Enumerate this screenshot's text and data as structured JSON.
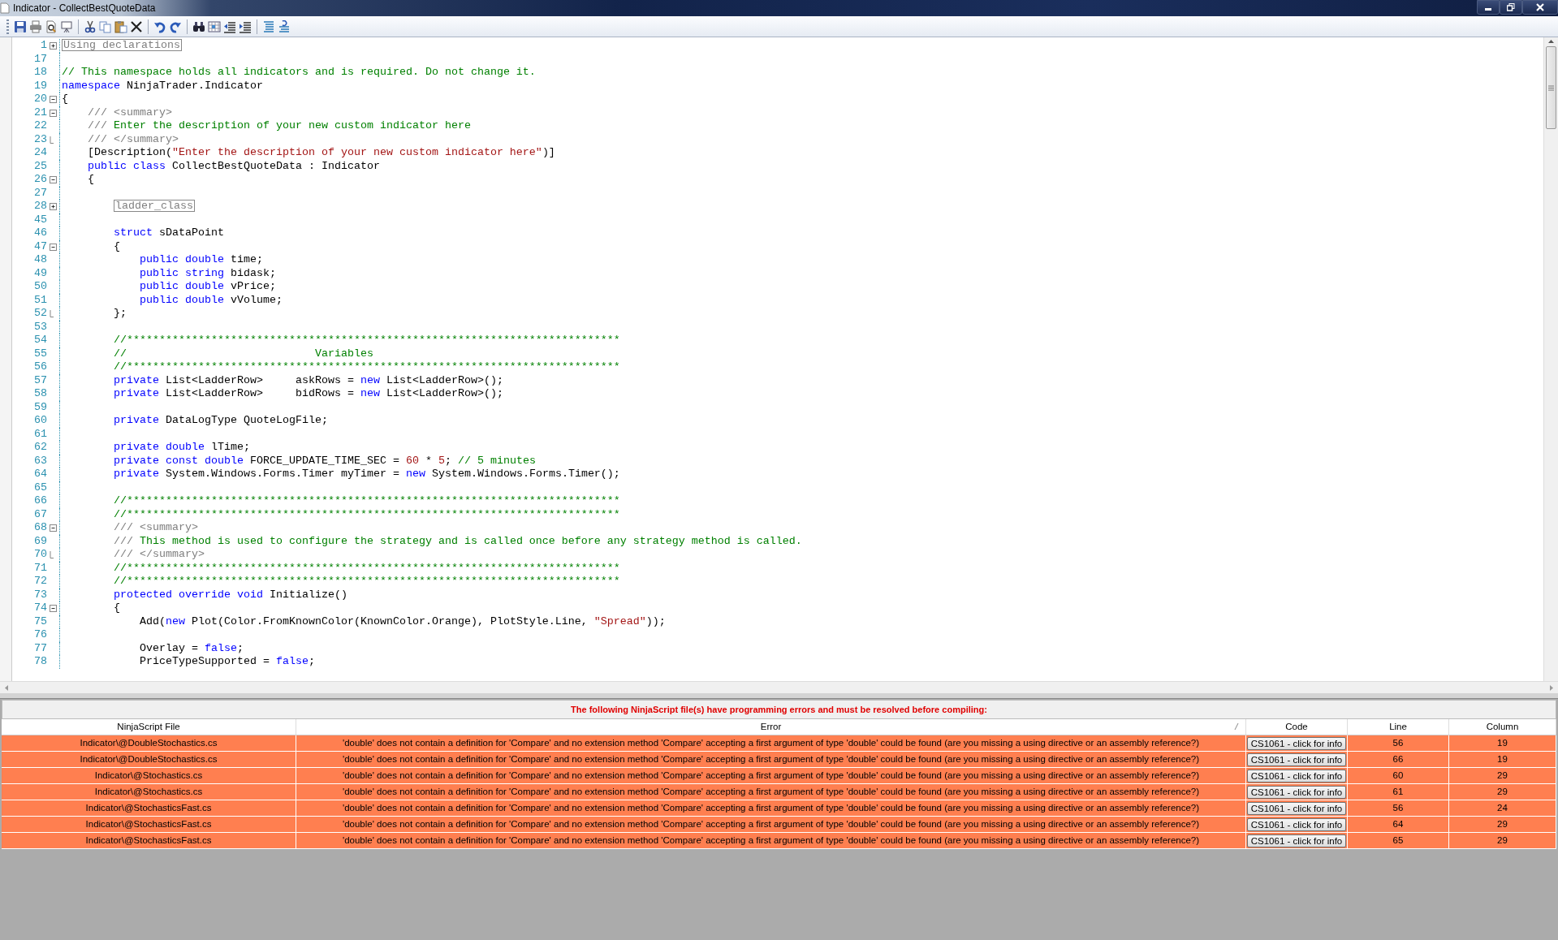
{
  "window": {
    "title": "Indicator - CollectBestQuoteData"
  },
  "editor": {
    "lines": [
      {
        "number": "1",
        "expanded": false,
        "tokens": [
          {
            "kind": "collapsed",
            "text": "Using declarations"
          }
        ]
      },
      {
        "number": "17"
      },
      {
        "number": "18",
        "tokens": [
          {
            "kind": "comment",
            "text": "// This namespace holds all indicators and is required. Do not change it."
          }
        ]
      },
      {
        "number": "19",
        "tokens": [
          {
            "kind": "keyword",
            "text": "namespace"
          },
          {
            "kind": "plain",
            "text": " NinjaTrader.Indicator"
          }
        ]
      },
      {
        "number": "20",
        "expanded": true,
        "tokens": [
          {
            "kind": "plain",
            "text": "{"
          }
        ],
        "children": [
          {
            "number": "21",
            "expanded": true,
            "tokens": [
              {
                "kind": "doc",
                "text": "/// <summary>"
              }
            ]
          },
          {
            "number": "22",
            "tokens": [
              {
                "kind": "doc",
                "text": "///"
              },
              {
                "kind": "comment",
                "text": " Enter the description of your new custom indicator here"
              }
            ]
          },
          {
            "number": "23",
            "fold_end": true,
            "tokens": [
              {
                "kind": "doc",
                "text": "/// </summary>"
              }
            ]
          },
          {
            "number": "24",
            "tokens": [
              {
                "kind": "plain",
                "text": "[Description("
              },
              {
                "kind": "string",
                "text": "\"Enter the description of your new custom indicator here\""
              },
              {
                "kind": "plain",
                "text": ")]"
              }
            ]
          },
          {
            "number": "25",
            "tokens": [
              {
                "kind": "keyword",
                "text": "public class"
              },
              {
                "kind": "plain",
                "text": " CollectBestQuoteData : Indicator"
              }
            ]
          },
          {
            "number": "26",
            "expanded": true,
            "tokens": [
              {
                "kind": "plain",
                "text": "{"
              }
            ],
            "children": [
              {
                "number": "27"
              },
              {
                "number": "28",
                "expanded": false,
                "tokens": [
                  {
                    "kind": "collapsed",
                    "text": "ladder_class"
                  }
                ]
              },
              {
                "number": "45"
              },
              {
                "number": "46",
                "tokens": [
                  {
                    "kind": "keyword",
                    "text": "struct"
                  },
                  {
                    "kind": "plain",
                    "text": " sDataPoint"
                  }
                ]
              },
              {
                "number": "47",
                "expanded": true,
                "tokens": [
                  {
                    "kind": "plain",
                    "text": "{"
                  }
                ],
                "children": [
                  {
                    "number": "48",
                    "tokens": [
                      {
                        "kind": "keyword",
                        "text": "public double"
                      },
                      {
                        "kind": "plain",
                        "text": " time;"
                      }
                    ]
                  },
                  {
                    "number": "49",
                    "tokens": [
                      {
                        "kind": "keyword",
                        "text": "public string"
                      },
                      {
                        "kind": "plain",
                        "text": " bidask;"
                      }
                    ]
                  },
                  {
                    "number": "50",
                    "tokens": [
                      {
                        "kind": "keyword",
                        "text": "public double"
                      },
                      {
                        "kind": "plain",
                        "text": " vPrice;"
                      }
                    ]
                  },
                  {
                    "number": "51",
                    "tokens": [
                      {
                        "kind": "keyword",
                        "text": "public double"
                      },
                      {
                        "kind": "plain",
                        "text": " vVolume;"
                      }
                    ]
                  }
                ]
              },
              {
                "number": "52",
                "fold_end": true,
                "tokens": [
                  {
                    "kind": "plain",
                    "text": "};"
                  }
                ]
              },
              {
                "number": "53"
              },
              {
                "number": "54",
                "tokens": [
                  {
                    "kind": "comment",
                    "text": "//****************************************************************************"
                  }
                ]
              },
              {
                "number": "55",
                "tokens": [
                  {
                    "kind": "comment",
                    "text": "//                             Variables"
                  }
                ]
              },
              {
                "number": "56",
                "tokens": [
                  {
                    "kind": "comment",
                    "text": "//****************************************************************************"
                  }
                ]
              },
              {
                "number": "57",
                "tokens": [
                  {
                    "kind": "keyword",
                    "text": "private"
                  },
                  {
                    "kind": "plain",
                    "text": " List<LadderRow>     askRows = "
                  },
                  {
                    "kind": "keyword",
                    "text": "new"
                  },
                  {
                    "kind": "plain",
                    "text": " List<LadderRow>();"
                  }
                ]
              },
              {
                "number": "58",
                "tokens": [
                  {
                    "kind": "keyword",
                    "text": "private"
                  },
                  {
                    "kind": "plain",
                    "text": " List<LadderRow>     bidRows = "
                  },
                  {
                    "kind": "keyword",
                    "text": "new"
                  },
                  {
                    "kind": "plain",
                    "text": " List<LadderRow>();"
                  }
                ]
              },
              {
                "number": "59"
              },
              {
                "number": "60",
                "tokens": [
                  {
                    "kind": "keyword",
                    "text": "private"
                  },
                  {
                    "kind": "plain",
                    "text": " DataLogType QuoteLogFile;"
                  }
                ]
              },
              {
                "number": "61"
              },
              {
                "number": "62",
                "tokens": [
                  {
                    "kind": "keyword",
                    "text": "private double"
                  },
                  {
                    "kind": "plain",
                    "text": " lTime;"
                  }
                ]
              },
              {
                "number": "63",
                "tokens": [
                  {
                    "kind": "keyword",
                    "text": "private const double"
                  },
                  {
                    "kind": "plain",
                    "text": " FORCE_UPDATE_TIME_SEC = "
                  },
                  {
                    "kind": "number",
                    "text": "60"
                  },
                  {
                    "kind": "plain",
                    "text": " * "
                  },
                  {
                    "kind": "number",
                    "text": "5"
                  },
                  {
                    "kind": "plain",
                    "text": ";"
                  },
                  {
                    "kind": "comment",
                    "text": " // 5 minutes"
                  }
                ]
              },
              {
                "number": "64",
                "tokens": [
                  {
                    "kind": "keyword",
                    "text": "private"
                  },
                  {
                    "kind": "plain",
                    "text": " System.Windows.Forms.Timer myTimer = "
                  },
                  {
                    "kind": "keyword",
                    "text": "new"
                  },
                  {
                    "kind": "plain",
                    "text": " System.Windows.Forms.Timer();"
                  }
                ]
              },
              {
                "number": "65"
              },
              {
                "number": "66",
                "tokens": [
                  {
                    "kind": "comment",
                    "text": "//****************************************************************************"
                  }
                ]
              },
              {
                "number": "67",
                "tokens": [
                  {
                    "kind": "comment",
                    "text": "//****************************************************************************"
                  }
                ]
              },
              {
                "number": "68",
                "expanded": true,
                "tokens": [
                  {
                    "kind": "doc",
                    "text": "/// <summary>"
                  }
                ]
              },
              {
                "number": "69",
                "tokens": [
                  {
                    "kind": "doc",
                    "text": "///"
                  },
                  {
                    "kind": "comment",
                    "text": " This method is used to configure the strategy and is called once before any strategy method is called."
                  }
                ]
              },
              {
                "number": "70",
                "fold_end": true,
                "tokens": [
                  {
                    "kind": "doc",
                    "text": "/// </summary>"
                  }
                ]
              },
              {
                "number": "71",
                "tokens": [
                  {
                    "kind": "comment",
                    "text": "//****************************************************************************"
                  }
                ]
              },
              {
                "number": "72",
                "tokens": [
                  {
                    "kind": "comment",
                    "text": "//****************************************************************************"
                  }
                ]
              },
              {
                "number": "73",
                "tokens": [
                  {
                    "kind": "keyword",
                    "text": "protected override void"
                  },
                  {
                    "kind": "plain",
                    "text": " Initialize()"
                  }
                ]
              },
              {
                "number": "74",
                "expanded": true,
                "tokens": [
                  {
                    "kind": "plain",
                    "text": "{"
                  }
                ],
                "children": [
                  {
                    "number": "75",
                    "tokens": [
                      {
                        "kind": "plain",
                        "text": "Add("
                      },
                      {
                        "kind": "keyword",
                        "text": "new"
                      },
                      {
                        "kind": "plain",
                        "text": " Plot(Color.FromKnownColor(KnownColor.Orange), PlotStyle.Line, "
                      },
                      {
                        "kind": "string",
                        "text": "\"Spread\""
                      },
                      {
                        "kind": "plain",
                        "text": "));"
                      }
                    ]
                  },
                  {
                    "number": "76"
                  },
                  {
                    "number": "77",
                    "tokens": [
                      {
                        "kind": "plain",
                        "text": "Overlay = "
                      },
                      {
                        "kind": "keyword",
                        "text": "false"
                      },
                      {
                        "kind": "plain",
                        "text": ";"
                      }
                    ]
                  },
                  {
                    "number": "78",
                    "tokens": [
                      {
                        "kind": "plain",
                        "text": "PriceTypeSupported = "
                      },
                      {
                        "kind": "keyword",
                        "text": "false"
                      },
                      {
                        "kind": "plain",
                        "text": ";"
                      }
                    ]
                  }
                ]
              }
            ]
          }
        ]
      }
    ]
  },
  "errors": {
    "message": "The following NinjaScript file(s) have programming errors and must be resolved before compiling:",
    "columns": [
      "NinjaScript File",
      "Error",
      "Code",
      "Line",
      "Column"
    ],
    "rows": [
      {
        "file": "Indicator\\@DoubleStochastics.cs",
        "error": "'double' does not contain a definition for 'Compare' and no extension method 'Compare' accepting a first argument of type 'double' could be found (are you missing a using directive or an assembly reference?)",
        "code": "CS1061 - click for info",
        "line": "56",
        "column": "19"
      },
      {
        "file": "Indicator\\@DoubleStochastics.cs",
        "error": "'double' does not contain a definition for 'Compare' and no extension method 'Compare' accepting a first argument of type 'double' could be found (are you missing a using directive or an assembly reference?)",
        "code": "CS1061 - click for info",
        "line": "66",
        "column": "19"
      },
      {
        "file": "Indicator\\@Stochastics.cs",
        "error": "'double' does not contain a definition for 'Compare' and no extension method 'Compare' accepting a first argument of type 'double' could be found (are you missing a using directive or an assembly reference?)",
        "code": "CS1061 - click for info",
        "line": "60",
        "column": "29"
      },
      {
        "file": "Indicator\\@Stochastics.cs",
        "error": "'double' does not contain a definition for 'Compare' and no extension method 'Compare' accepting a first argument of type 'double' could be found (are you missing a using directive or an assembly reference?)",
        "code": "CS1061 - click for info",
        "line": "61",
        "column": "29"
      },
      {
        "file": "Indicator\\@StochasticsFast.cs",
        "error": "'double' does not contain a definition for 'Compare' and no extension method 'Compare' accepting a first argument of type 'double' could be found (are you missing a using directive or an assembly reference?)",
        "code": "CS1061 - click for info",
        "line": "56",
        "column": "24"
      },
      {
        "file": "Indicator\\@StochasticsFast.cs",
        "error": "'double' does not contain a definition for 'Compare' and no extension method 'Compare' accepting a first argument of type 'double' could be found (are you missing a using directive or an assembly reference?)",
        "code": "CS1061 - click for info",
        "line": "64",
        "column": "29"
      },
      {
        "file": "Indicator\\@StochasticsFast.cs",
        "error": "'double' does not contain a definition for 'Compare' and no extension method 'Compare' accepting a first argument of type 'double' could be found (are you missing a using directive or an assembly reference?)",
        "code": "CS1061 - click for info",
        "line": "65",
        "column": "29"
      }
    ]
  }
}
